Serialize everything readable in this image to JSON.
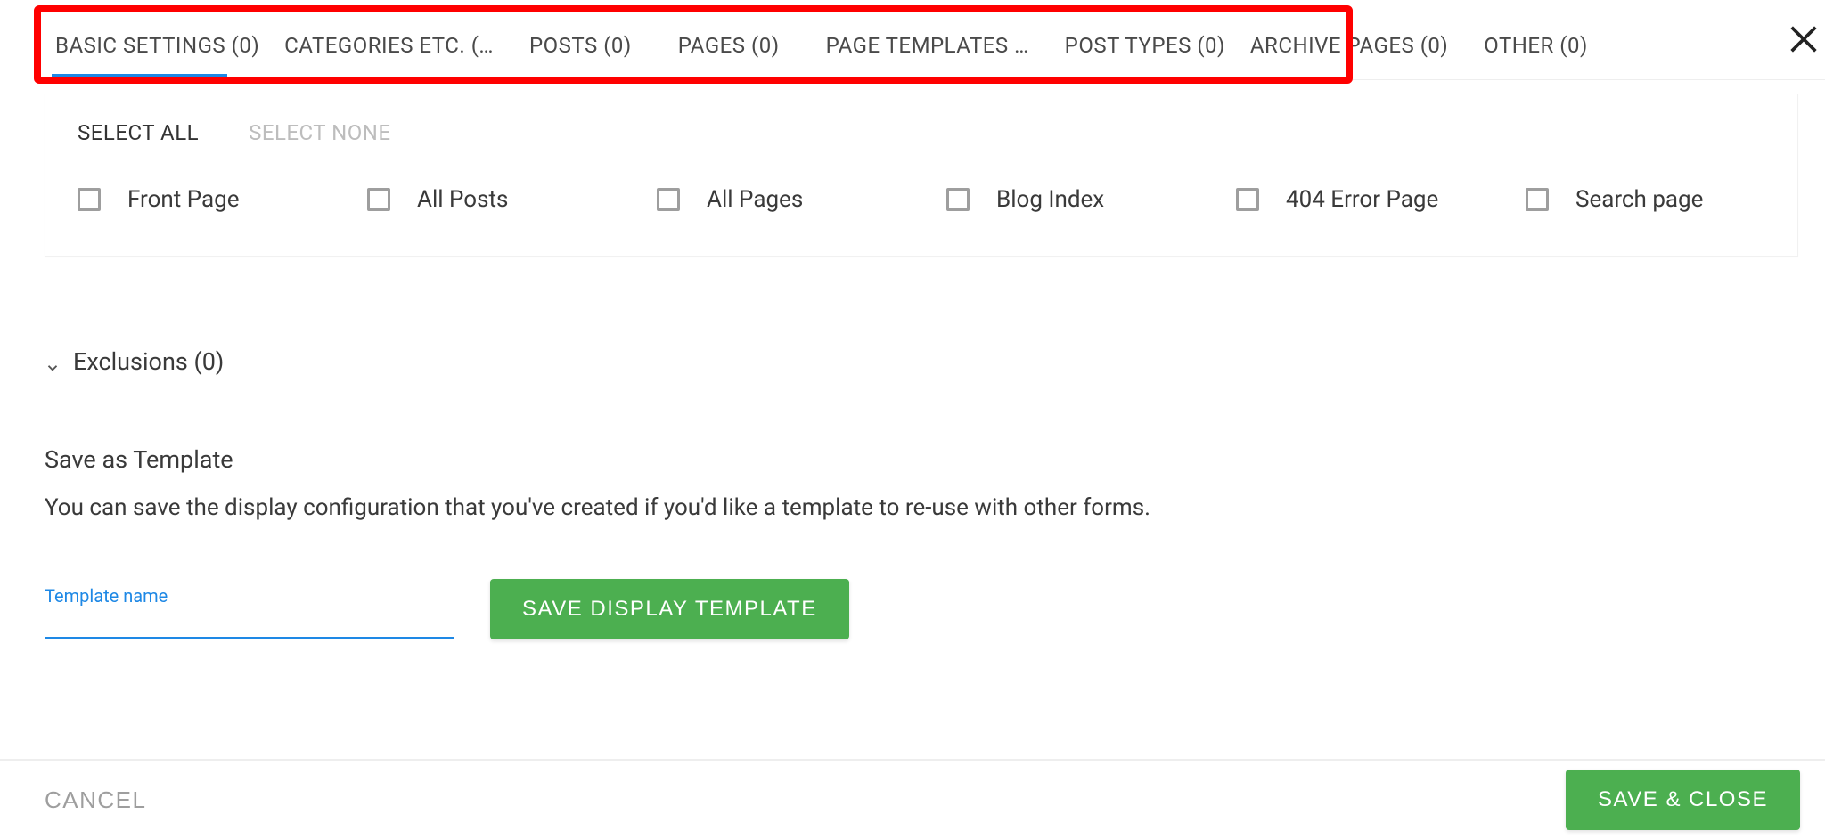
{
  "tabs": [
    {
      "label": "BASIC SETTINGS (0)",
      "active": true
    },
    {
      "label": "CATEGORIES ETC. (…",
      "active": false
    },
    {
      "label": "POSTS (0)",
      "active": false
    },
    {
      "label": "PAGES (0)",
      "active": false
    },
    {
      "label": "PAGE TEMPLATES …",
      "active": false
    },
    {
      "label": "POST TYPES (0)",
      "active": false
    },
    {
      "label": "ARCHIVE PAGES (0)",
      "active": false
    },
    {
      "label": "OTHER (0)",
      "active": false
    }
  ],
  "selection": {
    "select_all": "SELECT ALL",
    "select_none": "SELECT NONE"
  },
  "checkboxes": [
    {
      "label": "Front Page"
    },
    {
      "label": "All Posts"
    },
    {
      "label": "All Pages"
    },
    {
      "label": "Blog Index"
    },
    {
      "label": "404 Error Page"
    },
    {
      "label": "Search page"
    }
  ],
  "exclusions": {
    "label": "Exclusions (0)"
  },
  "save_template": {
    "title": "Save as Template",
    "desc": "You can save the display configuration that you've created if you'd like a template to re-use with other forms.",
    "field_label": "Template name",
    "button": "SAVE DISPLAY TEMPLATE"
  },
  "footer": {
    "cancel": "CANCEL",
    "save_close": "SAVE & CLOSE"
  }
}
